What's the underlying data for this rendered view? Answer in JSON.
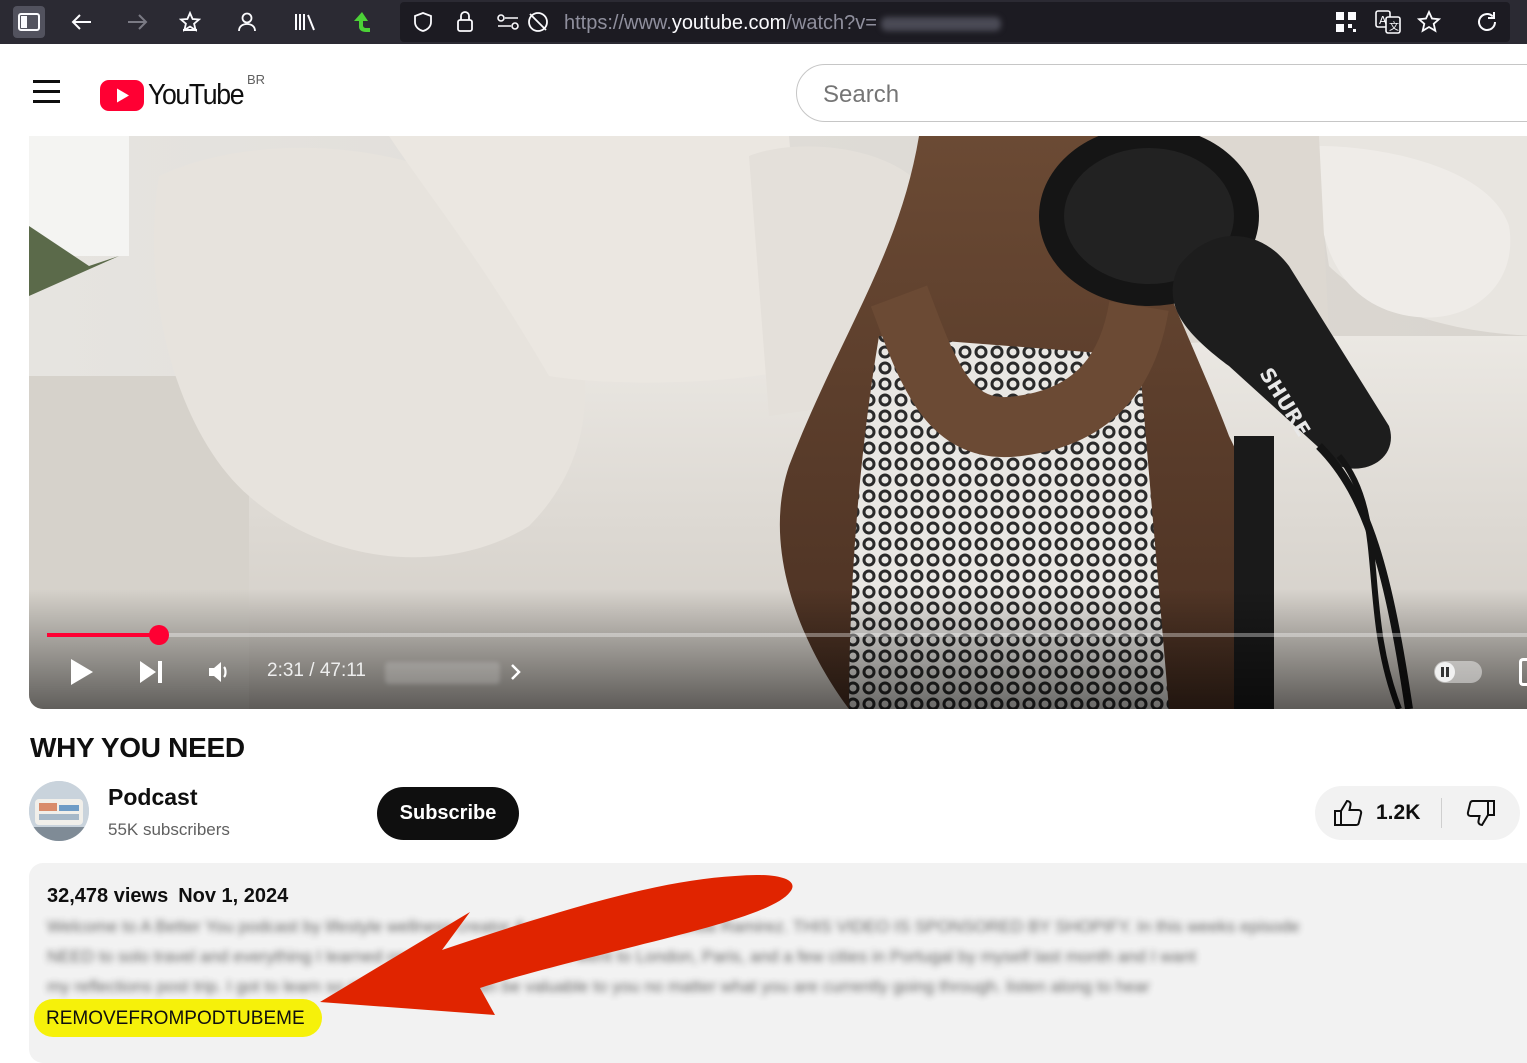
{
  "browser": {
    "url_prefix": "https://www.",
    "url_host": "youtube.com",
    "url_path": "/watch?v="
  },
  "header": {
    "logo_text": "YouTube",
    "region": "BR",
    "search_placeholder": "Search"
  },
  "player": {
    "time": "2:31 / 47:11",
    "progress_fraction": 0.076
  },
  "video": {
    "title": "WHY YOU NEED",
    "channel_name": "Podcast",
    "subscribers": "55K subscribers",
    "subscribe_label": "Subscribe",
    "like_count": "1.2K"
  },
  "description": {
    "views": "32,478 views",
    "date": "Nov 1, 2024",
    "blurred_lines": [
      "Welcome to A Better You podcast by lifestyle wellness creator & entrepreneur - Fernanda Ramirez. THIS VIDEO IS SPONSORED BY SHOPIFY. In this weeks episode",
      "NEED to solo travel and everything I learned on my solo Europe trip! I went to London, Paris, and a few cities in Portugal by myself last month and I want",
      "my reflections post trip. I got to learn so much that I feel can be valuable to you no matter what you are currently going through. listen along to hear"
    ],
    "highlighted_tag": "REMOVEFROMPODTUBEME"
  },
  "colors": {
    "accent_red": "#ff0033",
    "highlight_yellow": "#f6f10a",
    "arrow_red": "#e02400"
  }
}
